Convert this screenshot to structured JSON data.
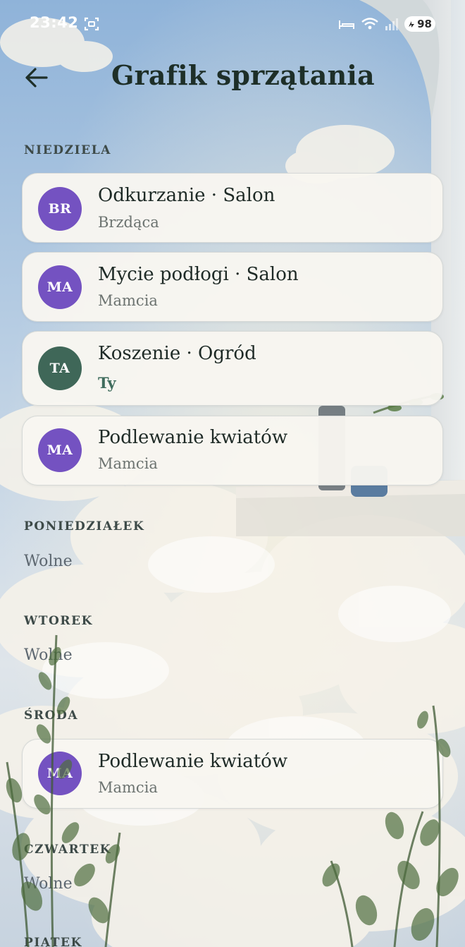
{
  "status_bar": {
    "time": "23:42",
    "battery": "98",
    "icons": [
      "screenshot-icon",
      "bed-icon",
      "wifi-icon",
      "signal-icon",
      "battery-icon"
    ]
  },
  "header": {
    "back_icon": "arrow-left-icon",
    "title": "Grafik sprzątania"
  },
  "colors": {
    "avatar_purple": "#7452c1",
    "avatar_green": "#3f6758",
    "card_bg": "#f8f6f0",
    "title_text": "#1e2f28"
  },
  "days": [
    {
      "label": "NIEDZIELA",
      "tasks": [
        {
          "initials": "BR",
          "title": "Odkurzanie · Salon",
          "person": "Brzdąca"
        },
        {
          "initials": "MA",
          "title": "Mycie podłogi · Salon",
          "person": "Mamcia"
        },
        {
          "initials": "TA",
          "title": "Koszenie · Ogród",
          "person": "Ty"
        },
        {
          "initials": "MA",
          "title": "Podlewanie kwiatów",
          "person": "Mamcia"
        }
      ]
    },
    {
      "label": "PONIEDZIAŁEK",
      "free": "Wolne"
    },
    {
      "label": "WTOREK",
      "free": "Wolne"
    },
    {
      "label": "ŚRODA",
      "tasks": [
        {
          "initials": "MA",
          "title": "Podlewanie kwiatów",
          "person": "Mamcia"
        }
      ]
    },
    {
      "label": "CZWARTEK",
      "free": "Wolne"
    },
    {
      "label": "PIĄTEK"
    }
  ]
}
